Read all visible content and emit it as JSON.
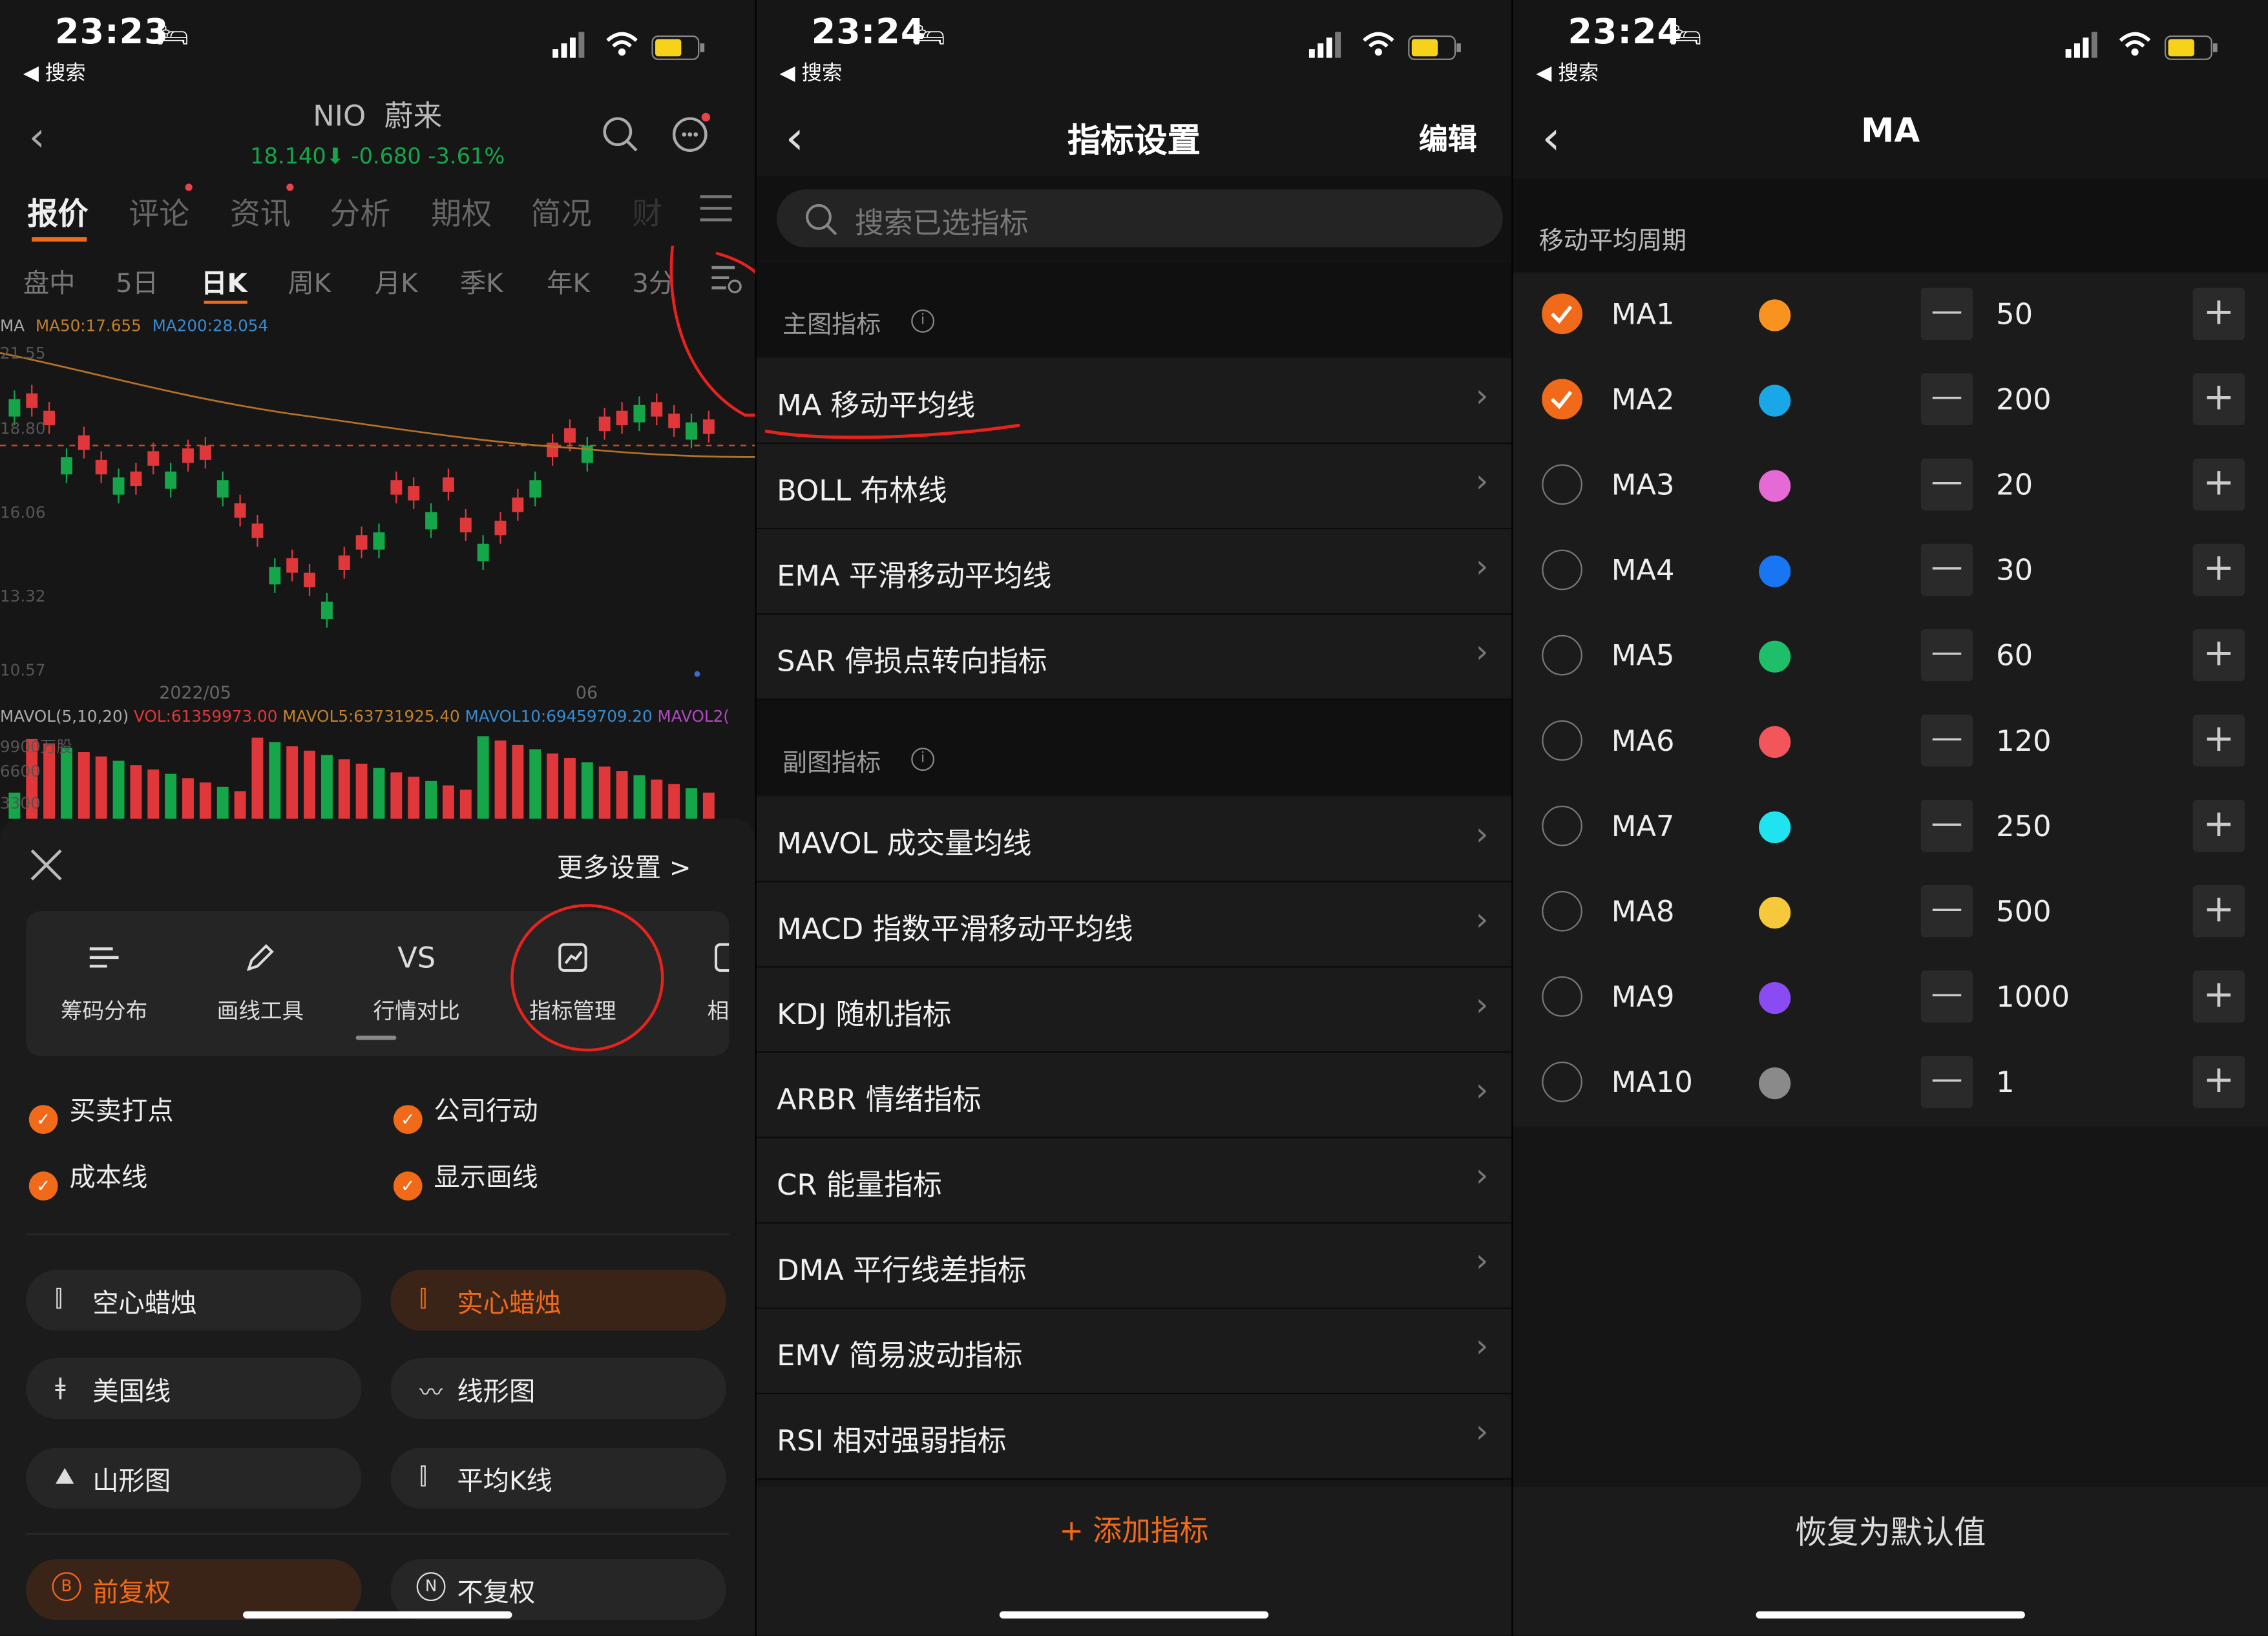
{
  "status_bars": [
    {
      "time": "23:23",
      "back_label": "◀ 搜索"
    },
    {
      "time": "23:24",
      "back_label": "◀ 搜索"
    },
    {
      "time": "23:24",
      "back_label": "◀ 搜索"
    }
  ],
  "panel1": {
    "ticker": "NIO",
    "name": "蔚来",
    "price_line": "18.140⬇ -0.680 -3.61%",
    "tabs": [
      "报价",
      "评论",
      "资讯",
      "分析",
      "期权",
      "简况",
      "财"
    ],
    "periods": [
      "盘中",
      "5日",
      "日K",
      "周K",
      "月K",
      "季K",
      "年K",
      "3分"
    ],
    "ma_legend": {
      "prefix": "MA",
      "ma50": "MA50:17.655",
      "ma200": "MA200:28.054"
    },
    "y_ticks": [
      "21.55",
      "18.80",
      "16.06",
      "13.32",
      "10.57"
    ],
    "x_ticks": [
      "2022/05",
      "06"
    ],
    "mavol_legend": {
      "prefix": "MAVOL(5,10,20)",
      "vol": "VOL:61359973.00",
      "mavol5": "MAVOL5:63731925.40",
      "mavol10": "MAVOL10:69459709.20",
      "mavol20": "MAVOL2("
    },
    "vol_ticks": [
      "9900万股",
      "6600",
      "3300"
    ],
    "more_settings": "更多设置 >",
    "tools": [
      "筹码分布",
      "画线工具",
      "行情对比",
      "指标管理",
      "相似"
    ],
    "tool_icons": [
      "chip-distribution-icon",
      "pencil-icon",
      "vs-icon",
      "indicator-manage-icon",
      "similar-icon"
    ],
    "vs_text": "VS",
    "options": [
      "买卖打点",
      "公司行动",
      "成本线",
      "显示画线"
    ],
    "chart_styles": [
      "空心蜡烛",
      "实心蜡烛",
      "美国线",
      "线形图",
      "山形图",
      "平均K线"
    ],
    "adjust": [
      "前复权",
      "不复权"
    ],
    "adjust_icons": [
      "B",
      "N"
    ],
    "colors": {
      "accent": "#f06a1a",
      "up": "#e0373a",
      "down": "#15a64a",
      "ma50": "#b5712a",
      "ma200": "#3a8ad0",
      "annotation": "#e8231e"
    }
  },
  "panel2": {
    "title": "指标设置",
    "edit": "编辑",
    "search_placeholder": "搜索已选指标",
    "main_section": "主图指标",
    "main_items": [
      "MA 移动平均线",
      "BOLL 布林线",
      "EMA 平滑移动平均线",
      "SAR 停损点转向指标"
    ],
    "sub_section": "副图指标",
    "sub_items": [
      "MAVOL 成交量均线",
      "MACD 指数平滑移动平均线",
      "KDJ 随机指标",
      "ARBR 情绪指标",
      "CR 能量指标",
      "DMA 平行线差指标",
      "EMV 简易波动指标",
      "RSI 相对强弱指标"
    ],
    "add": "+ 添加指标"
  },
  "panel3": {
    "title": "MA",
    "section": "移动平均周期",
    "rows": [
      {
        "label": "MA1",
        "value": "50",
        "checked": true,
        "color": "#f7931e"
      },
      {
        "label": "MA2",
        "value": "200",
        "checked": true,
        "color": "#1aa7e8"
      },
      {
        "label": "MA3",
        "value": "20",
        "checked": false,
        "color": "#e66ad6"
      },
      {
        "label": "MA4",
        "value": "30",
        "checked": false,
        "color": "#1876f2"
      },
      {
        "label": "MA5",
        "value": "60",
        "checked": false,
        "color": "#1fbf6a"
      },
      {
        "label": "MA6",
        "value": "120",
        "checked": false,
        "color": "#f2565a"
      },
      {
        "label": "MA7",
        "value": "250",
        "checked": false,
        "color": "#20e3f0"
      },
      {
        "label": "MA8",
        "value": "500",
        "checked": false,
        "color": "#f6c93a"
      },
      {
        "label": "MA9",
        "value": "1000",
        "checked": false,
        "color": "#8a4cf2"
      },
      {
        "label": "MA10",
        "value": "1",
        "checked": false,
        "color": "#8a8a8a"
      }
    ],
    "reset": "恢复为默认值"
  }
}
